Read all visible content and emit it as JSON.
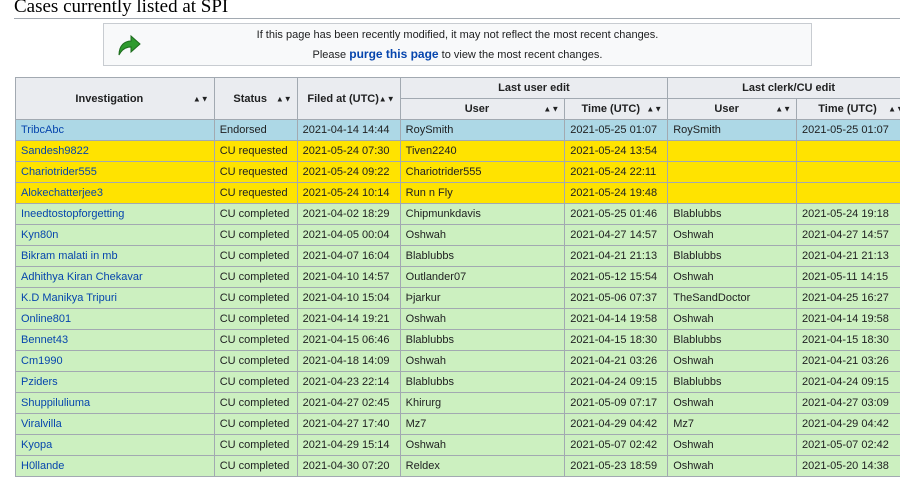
{
  "page_title": "Cases currently listed at SPI",
  "notice": {
    "line1": "If this page has been recently modified, it may not reflect the most recent changes.",
    "line2_pre": "Please",
    "purge_link": "purge this page",
    "line2_post": "to view the most recent changes."
  },
  "headers": {
    "investigation": "Investigation",
    "status": "Status",
    "filed": "Filed at (UTC)",
    "last_user_edit": "Last user edit",
    "last_clerk_edit": "Last clerk/CU edit",
    "user": "User",
    "time": "Time (UTC)"
  },
  "rows": [
    [
      "TribcAbc",
      "Endorsed",
      "2021-04-14 14:44",
      "RoySmith",
      "2021-05-25 01:07",
      "RoySmith",
      "2021-05-25 01:07"
    ],
    [
      "Sandesh9822",
      "CU requested",
      "2021-05-24 07:30",
      "Tiven2240",
      "2021-05-24 13:54",
      "",
      ""
    ],
    [
      "Chariotrider555",
      "CU requested",
      "2021-05-24 09:22",
      "Chariotrider555",
      "2021-05-24 22:11",
      "",
      ""
    ],
    [
      "Alokechatterjee3",
      "CU requested",
      "2021-05-24 10:14",
      "Run n Fly",
      "2021-05-24 19:48",
      "",
      ""
    ],
    [
      "Ineedtostopforgetting",
      "CU completed",
      "2021-04-02 18:29",
      "Chipmunkdavis",
      "2021-05-25 01:46",
      "Blablubbs",
      "2021-05-24 19:18"
    ],
    [
      "Kyn80n",
      "CU completed",
      "2021-04-05 00:04",
      "Oshwah",
      "2021-04-27 14:57",
      "Oshwah",
      "2021-04-27 14:57"
    ],
    [
      "Bikram malati in mb",
      "CU completed",
      "2021-04-07 16:04",
      "Blablubbs",
      "2021-04-21 21:13",
      "Blablubbs",
      "2021-04-21 21:13"
    ],
    [
      "Adhithya Kiran Chekavar",
      "CU completed",
      "2021-04-10 14:57",
      "Outlander07",
      "2021-05-12 15:54",
      "Oshwah",
      "2021-05-11 14:15"
    ],
    [
      "K.D Manikya Tripuri",
      "CU completed",
      "2021-04-10 15:04",
      "Þjarkur",
      "2021-05-06 07:37",
      "TheSandDoctor",
      "2021-04-25 16:27"
    ],
    [
      "Online801",
      "CU completed",
      "2021-04-14 19:21",
      "Oshwah",
      "2021-04-14 19:58",
      "Oshwah",
      "2021-04-14 19:58"
    ],
    [
      "Bennet43",
      "CU completed",
      "2021-04-15 06:46",
      "Blablubbs",
      "2021-04-15 18:30",
      "Blablubbs",
      "2021-04-15 18:30"
    ],
    [
      "Cm1990",
      "CU completed",
      "2021-04-18 14:09",
      "Oshwah",
      "2021-04-21 03:26",
      "Oshwah",
      "2021-04-21 03:26"
    ],
    [
      "Pziders",
      "CU completed",
      "2021-04-23 22:14",
      "Blablubbs",
      "2021-04-24 09:15",
      "Blablubbs",
      "2021-04-24 09:15"
    ],
    [
      "Shuppiluliuma",
      "CU completed",
      "2021-04-27 02:45",
      "Khirurg",
      "2021-05-09 07:17",
      "Oshwah",
      "2021-04-27 03:09"
    ],
    [
      "Viralvilla",
      "CU completed",
      "2021-04-27 17:40",
      "Mz7",
      "2021-04-29 04:42",
      "Mz7",
      "2021-04-29 04:42"
    ],
    [
      "Kyopa",
      "CU completed",
      "2021-04-29 15:14",
      "Oshwah",
      "2021-05-07 02:42",
      "Oshwah",
      "2021-05-07 02:42"
    ],
    [
      "H0llande",
      "CU completed",
      "2021-04-30 07:20",
      "Reldex",
      "2021-05-23 18:59",
      "Oshwah",
      "2021-05-20 14:38"
    ]
  ],
  "colors": {
    "endorsed": "#add8e6",
    "requested": "#ffe300",
    "completed": "#ccf0c0",
    "link": "#0645ad"
  }
}
